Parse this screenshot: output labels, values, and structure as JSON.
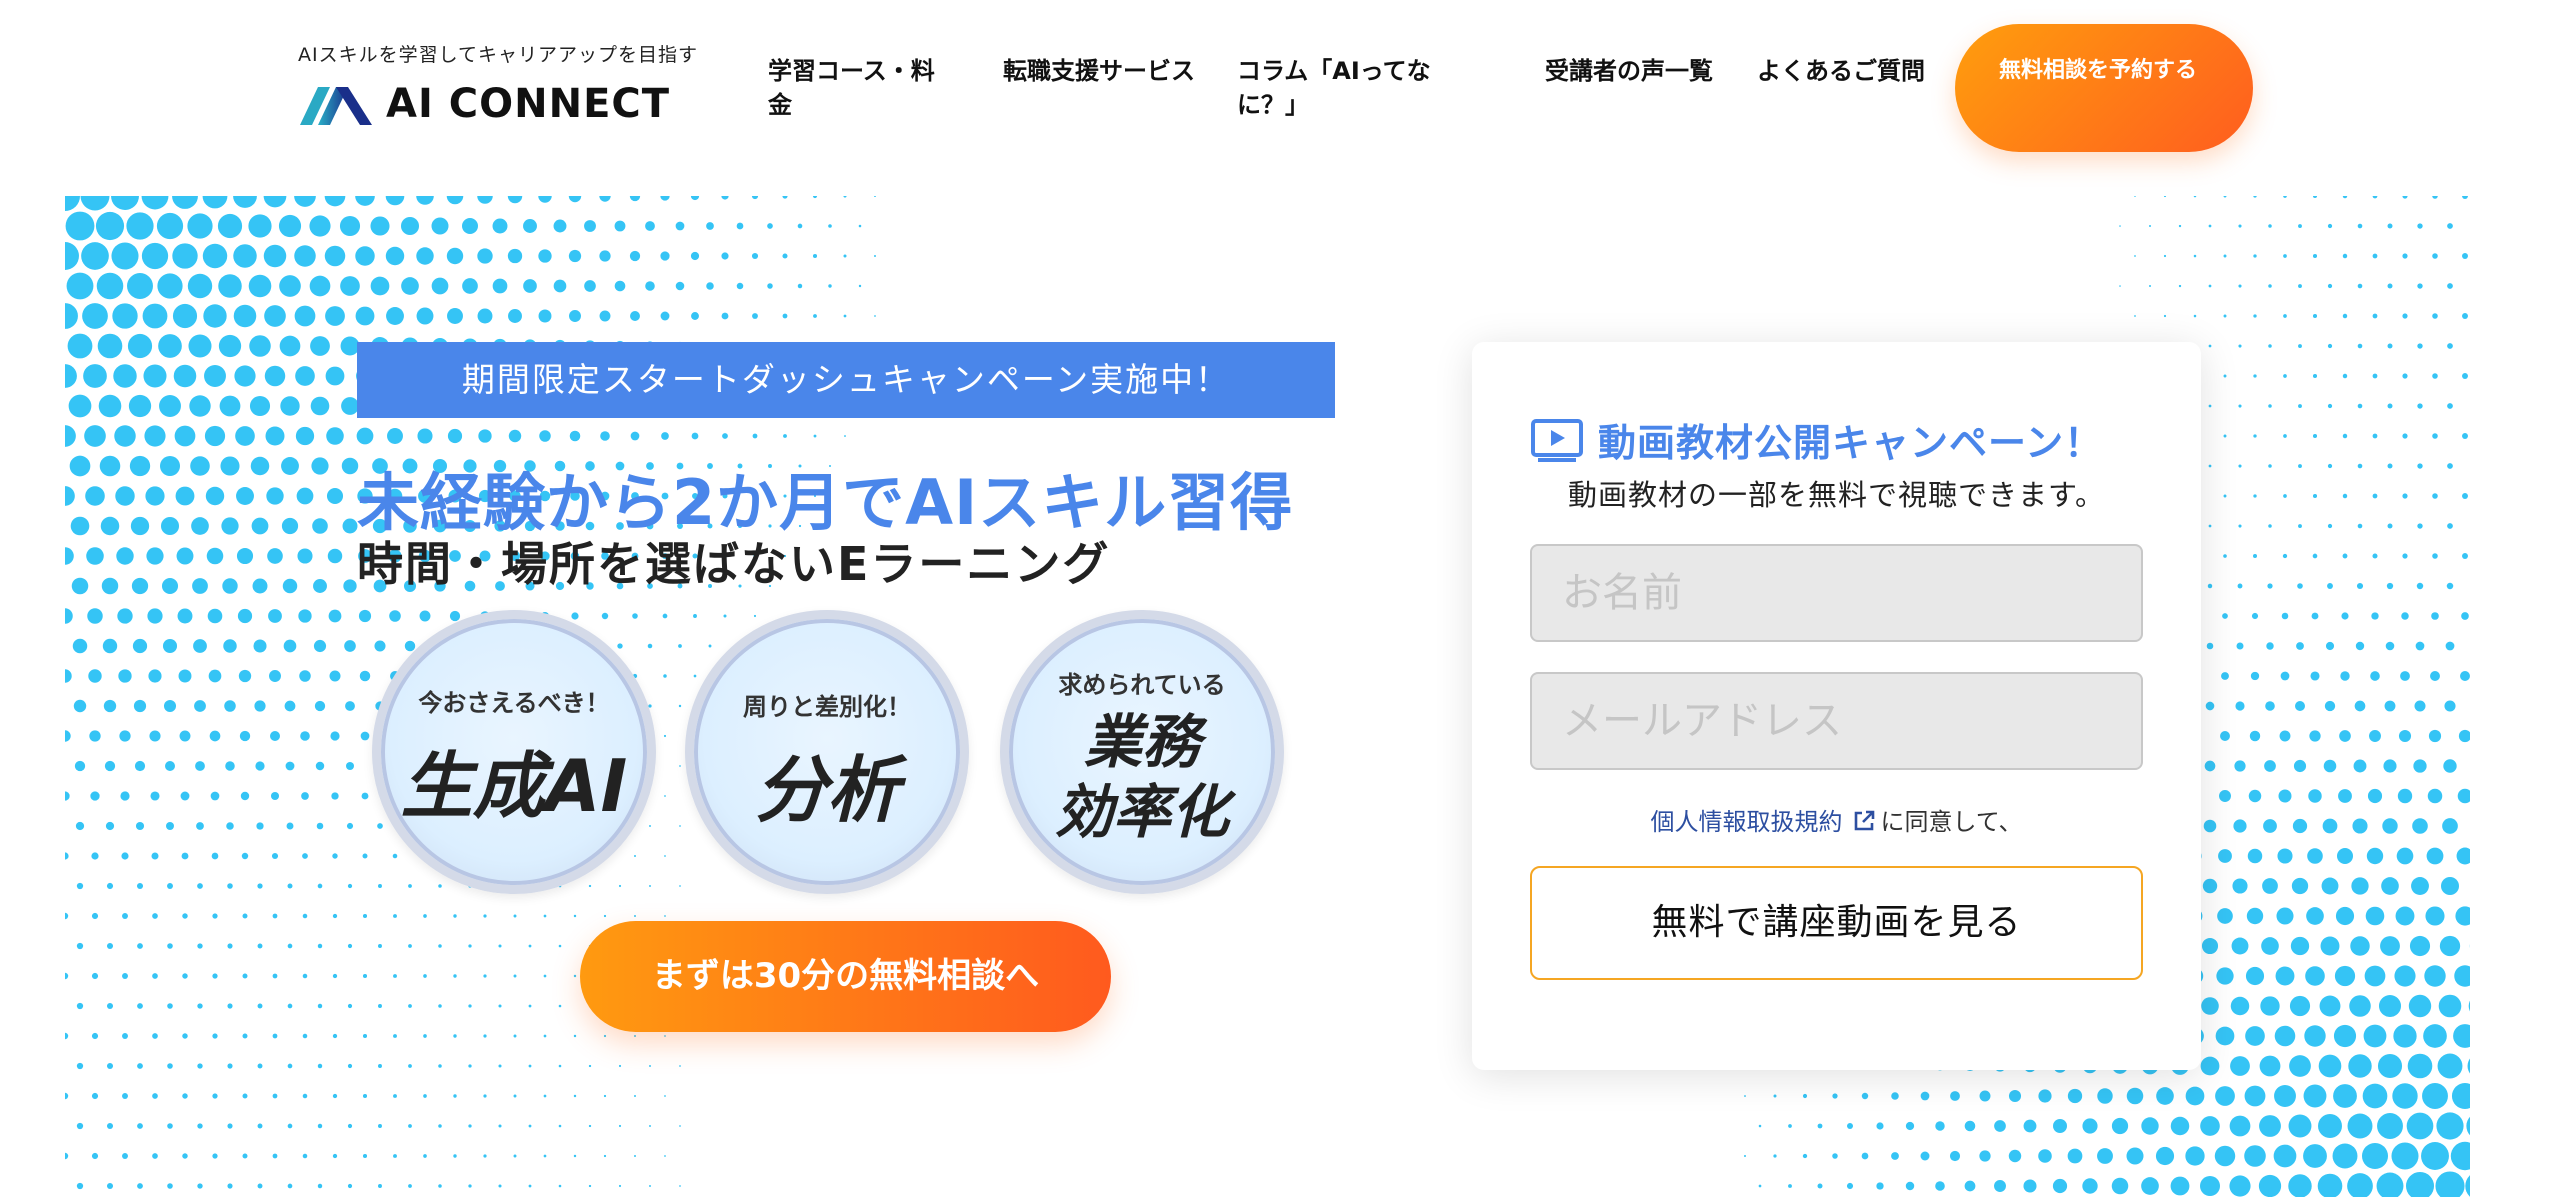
{
  "header": {
    "tagline": "AIスキルを学習してキャリアアップを目指す",
    "logo_text": "AI CONNECT",
    "nav": [
      {
        "label": "学習コース・料金"
      },
      {
        "label": "転職支援サービス"
      },
      {
        "label": "コラム「AIってなに？」"
      },
      {
        "label": "受講者の声一覧"
      },
      {
        "label": "よくあるご質問"
      }
    ],
    "cta_label": "無料相談を予約する"
  },
  "hero": {
    "banner": "期間限定スタートダッシュキャンペーン実施中！",
    "headline": "未経験から2か月でAIスキル習得",
    "subheadline": "時間・場所を選ばないEラーニング",
    "badges": [
      {
        "small": "今おさえるべき！",
        "big": "生成AI"
      },
      {
        "small": "周りと差別化！",
        "big": "分析"
      },
      {
        "small": "求められている",
        "big_line1": "業務",
        "big_line2": "効率化"
      }
    ],
    "cta_label": "まずは30分の無料相談へ"
  },
  "form": {
    "title": "動画教材公開キャンペーン！",
    "subtitle": "動画教材の一部を無料で視聴できます。",
    "name_placeholder": "お名前",
    "email_placeholder": "メールアドレス",
    "consent_link": "個人情報取扱規約",
    "consent_text": "に同意して、",
    "submit_label": "無料で講座動画を見る"
  },
  "colors": {
    "accent_blue": "#4a86ea",
    "dot_blue": "#35c4f5",
    "orange_start": "#ff9e0d",
    "orange_end": "#ff5a1e",
    "submit_border": "#f5a623"
  },
  "icons": [
    "logo-mark-icon",
    "video-play-icon",
    "external-link-icon"
  ]
}
